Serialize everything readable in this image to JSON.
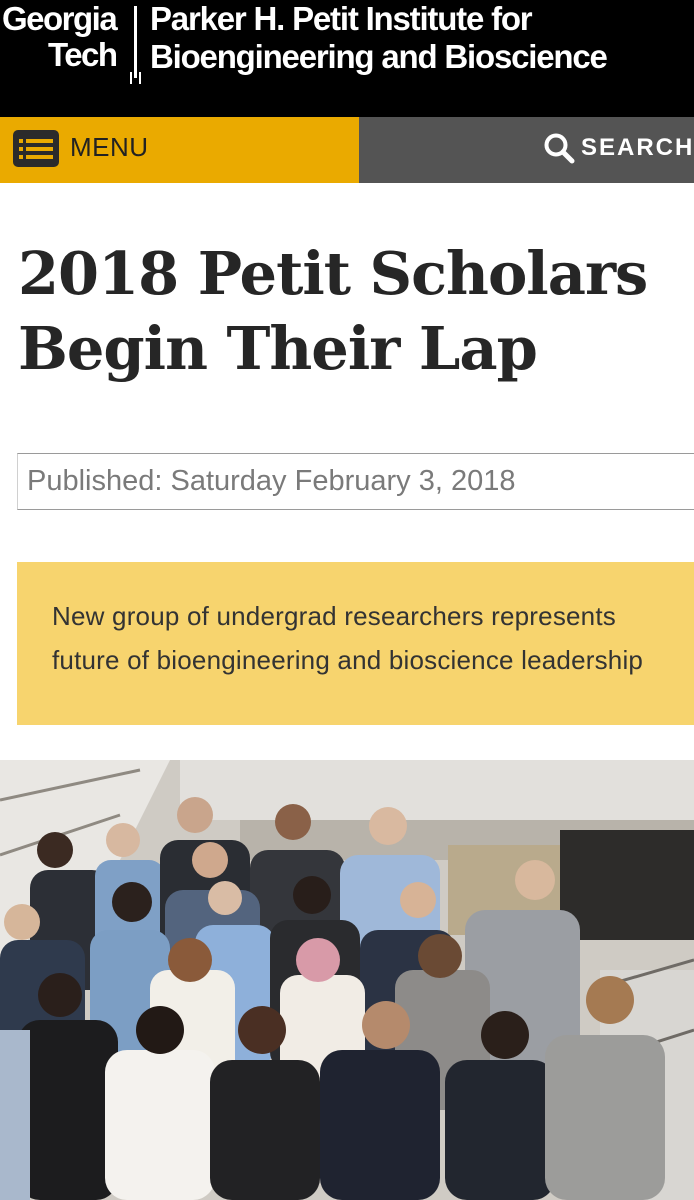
{
  "header": {
    "logo_line1": "Georgia",
    "logo_line2": "Tech",
    "institute_line1": "Parker H. Petit Institute for",
    "institute_line2": "Bioengineering and Bioscience"
  },
  "nav": {
    "menu_label": "MENU",
    "search_label": "SEARCH",
    "menu_icon": "list-menu-icon",
    "search_icon": "magnifier-icon"
  },
  "article": {
    "title_line1": "2018 Petit Scholars",
    "title_line2": "Begin Their Lap",
    "published": "Published: Saturday February 3, 2018",
    "summary_line1": "New group of undergrad researchers represents",
    "summary_line2": "future of bioengineering and bioscience leadership"
  },
  "colors": {
    "gold": "#EAAA00",
    "gray_nav": "#545454",
    "summary_bg": "#F7D46E",
    "header_bg": "#000000"
  }
}
